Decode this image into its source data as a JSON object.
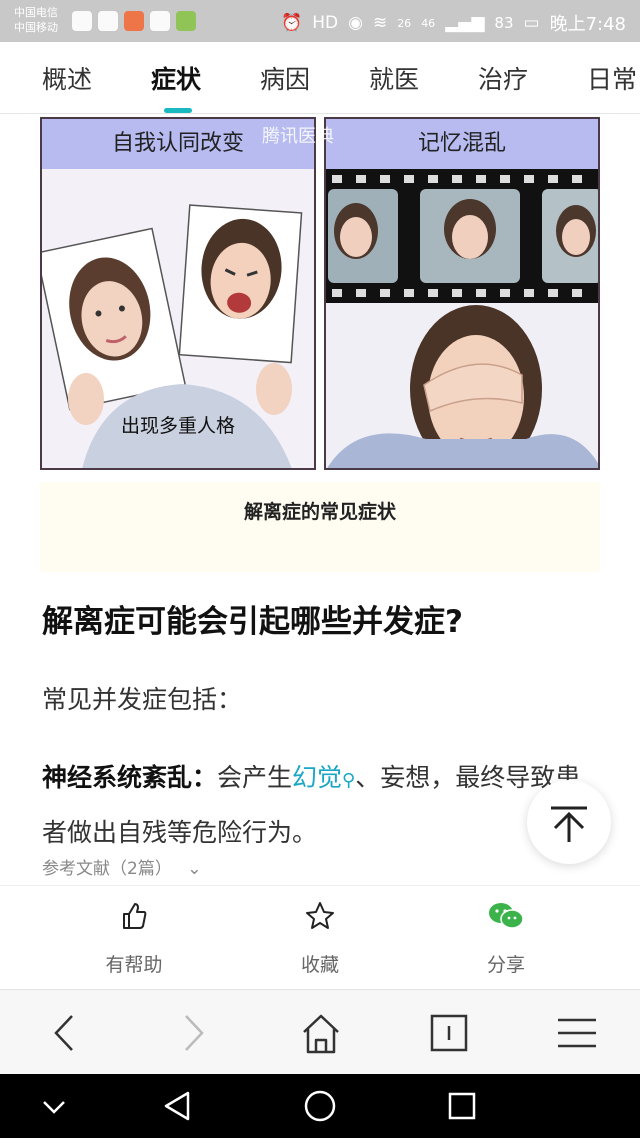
{
  "status_bar": {
    "carrier_1": "中国电信",
    "carrier_2": "中国移动",
    "net_1": "26",
    "net_2": "46",
    "battery": "83",
    "time": "晚上7:48"
  },
  "tabs": [
    {
      "label": "概述"
    },
    {
      "label": "症状"
    },
    {
      "label": "病因"
    },
    {
      "label": "就医"
    },
    {
      "label": "治疗"
    },
    {
      "label": "日常"
    }
  ],
  "illustration": {
    "left_title": "自我认同改变",
    "left_caption": "出现多重人格",
    "right_title": "记忆混乱",
    "watermark": "腾讯医典",
    "caption": "解离症的常见症状"
  },
  "article": {
    "heading": "解离症可能会引起哪些并发症?",
    "intro": "常见并发症包括：",
    "item_title": "神经系统紊乱：",
    "item_text_1": "会产生",
    "item_link": "幻觉",
    "item_text_2": "、妄想，最终导致患者做出自残等危险行为。",
    "refs": "参考文献（2篇）"
  },
  "actions": {
    "helpful": "有帮助",
    "favorite": "收藏",
    "share": "分享"
  },
  "colors": {
    "accent": "#19b9c1",
    "link": "#19a7c4",
    "share_green": "#3bb34a"
  }
}
